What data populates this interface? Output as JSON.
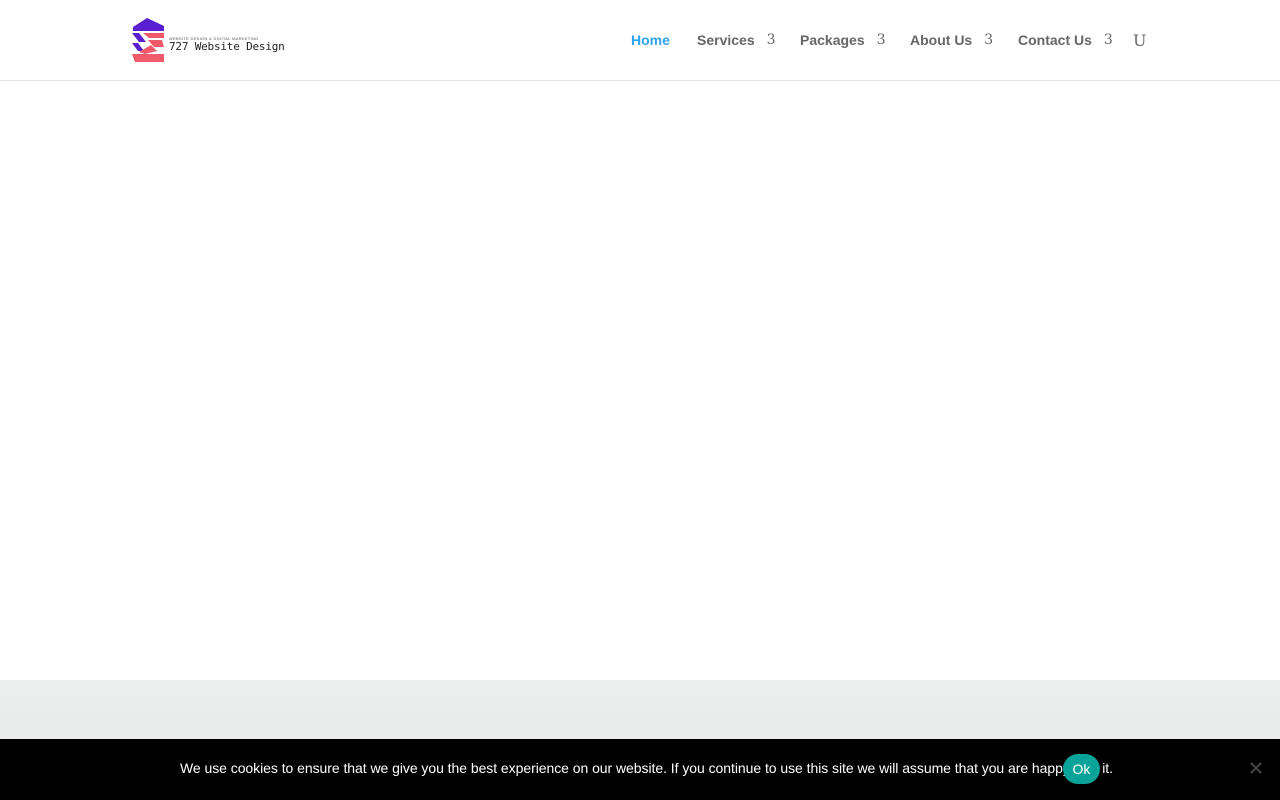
{
  "header": {
    "logo": {
      "tagline": "WEBSITE DESIGN & DIGITAL MARKETING",
      "name": "727 Website Design"
    },
    "nav": [
      {
        "label": "Home",
        "caret": ""
      },
      {
        "label": "Services",
        "caret": "3"
      },
      {
        "label": "Packages",
        "caret": "3"
      },
      {
        "label": "About Us",
        "caret": "3"
      },
      {
        "label": "Contact Us",
        "caret": "3"
      }
    ],
    "search_glyph": "U",
    "active_color": "#2ea3f2",
    "text_color": "#666666"
  },
  "cookie_banner": {
    "message": "We use cookies to ensure that we give you the best experience on our website. If you continue to use this site we will assume that you are happy with it.",
    "ok_label": "Ok",
    "ok_color": "#0aa39a",
    "close_icon": "close-icon"
  },
  "colors": {
    "logo_purple": "#5a1fd0",
    "logo_coral": "#f05a6a",
    "section_gray": "#eceeee"
  }
}
